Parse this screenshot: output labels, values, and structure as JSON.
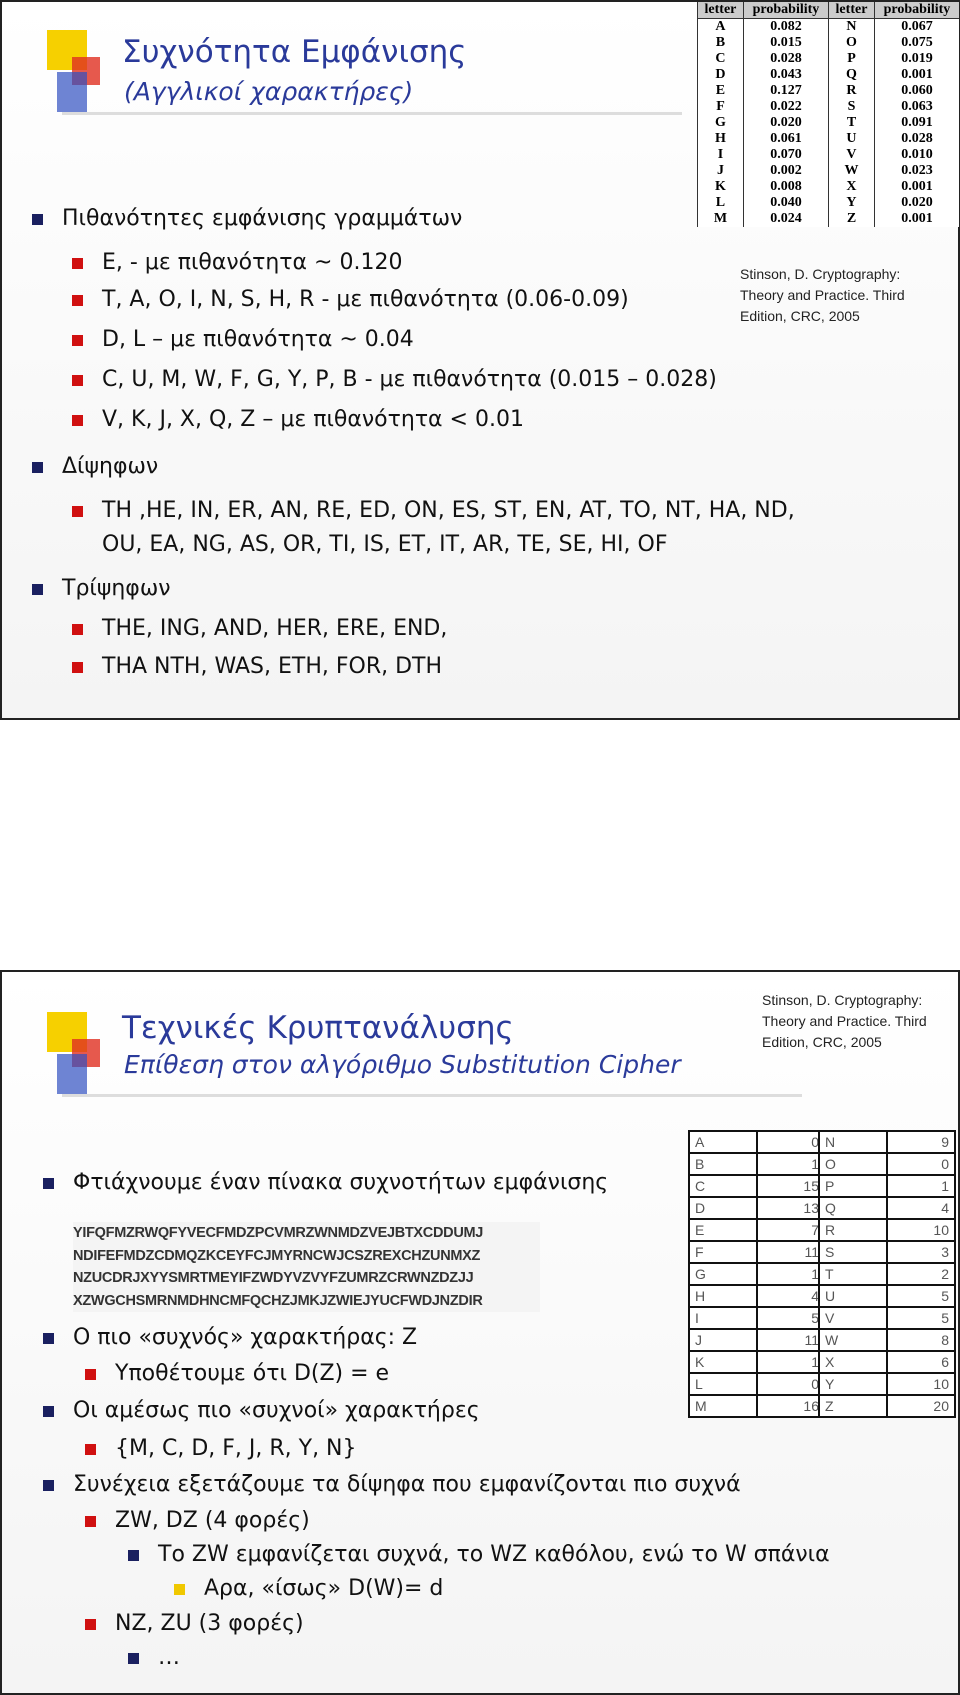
{
  "slide1": {
    "title": "Συχνότητα Εμφάνισης",
    "subtitle": "(Αγγλικοί χαρακτήρες)",
    "table": {
      "headers": [
        "letter",
        "probability",
        "letter",
        "probability"
      ],
      "left": [
        [
          "A",
          "0.082"
        ],
        [
          "B",
          "0.015"
        ],
        [
          "C",
          "0.028"
        ],
        [
          "D",
          "0.043"
        ],
        [
          "E",
          "0.127"
        ],
        [
          "F",
          "0.022"
        ],
        [
          "G",
          "0.020"
        ],
        [
          "H",
          "0.061"
        ],
        [
          "I",
          "0.070"
        ],
        [
          "J",
          "0.002"
        ],
        [
          "K",
          "0.008"
        ],
        [
          "L",
          "0.040"
        ],
        [
          "M",
          "0.024"
        ]
      ],
      "right": [
        [
          "N",
          "0.067"
        ],
        [
          "O",
          "0.075"
        ],
        [
          "P",
          "0.019"
        ],
        [
          "Q",
          "0.001"
        ],
        [
          "R",
          "0.060"
        ],
        [
          "S",
          "0.063"
        ],
        [
          "T",
          "0.091"
        ],
        [
          "U",
          "0.028"
        ],
        [
          "V",
          "0.010"
        ],
        [
          "W",
          "0.023"
        ],
        [
          "X",
          "0.001"
        ],
        [
          "Y",
          "0.020"
        ],
        [
          "Z",
          "0.001"
        ]
      ]
    },
    "citation": [
      "Stinson, D. Cryptography:",
      "Theory and Practice. Third",
      "Edition, CRC, 2005"
    ],
    "bullets": [
      {
        "level": 1,
        "text": "Πιθανότητες εμφάνισης γραμμάτων"
      },
      {
        "level": 2,
        "text": "E, - με πιθανότητα ~ 0.120"
      },
      {
        "level": 2,
        "text": "T, A, O, I, N, S, H, R - με πιθανότητα (0.06-0.09)"
      },
      {
        "level": 2,
        "text": "D, L – με πιθανότητα ~ 0.04"
      },
      {
        "level": 2,
        "text": "C, U, M, W, F, G, Y, P, B - με πιθανότητα (0.015 – 0.028)"
      },
      {
        "level": 2,
        "text": "V, K, J, X, Q, Z – με πιθανότητα < 0.01"
      },
      {
        "level": 1,
        "text": "Δίψηφων"
      },
      {
        "level": 2,
        "text": "TH ,HE, IN, ER, AN, RE, ED, ON, ES, ST, EN, AT, TO, NT, HA, ND,"
      },
      {
        "level": 0,
        "text": "OU, EA, NG, AS, OR, TI, IS, ET, IT, AR, TE, SE, HI, OF"
      },
      {
        "level": 1,
        "text": "Τρίψηφων"
      },
      {
        "level": 2,
        "text": "THE, ING, AND, HER, ERE, END,"
      },
      {
        "level": 2,
        "text": "THA NTH, WAS, ETH, FOR, DTH"
      }
    ]
  },
  "slide2": {
    "title": "Τεχνικές Κρυπτανάλυσης",
    "subtitle": "Επίθεση στον αλγόριθμο Substitution Cipher",
    "citation": [
      "Stinson, D. Cryptography:",
      "Theory and Practice. Third",
      "Edition, CRC, 2005"
    ],
    "ciphertext": [
      "YIFQFMZRWQFYVECFMDZPCVMRZWNMDZVEJBTXCDDUMJ",
      "NDIFEFMDZCDMQZKCEYFCJMYRNCWJCSZREXCHZUNMXZ",
      "NZUCDRJXYYSMRTMEYIFZWDYVZVYFZUMRZCRWNZDZJJ",
      "XZWGCHSMRNMDHNCMFQCHZJMKJZWIEJYUCFWDJNZDIR"
    ],
    "counts": {
      "left": [
        [
          "A",
          "0"
        ],
        [
          "B",
          "1"
        ],
        [
          "C",
          "15"
        ],
        [
          "D",
          "13"
        ],
        [
          "E",
          "7"
        ],
        [
          "F",
          "11"
        ],
        [
          "G",
          "1"
        ],
        [
          "H",
          "4"
        ],
        [
          "I",
          "5"
        ],
        [
          "J",
          "11"
        ],
        [
          "K",
          "1"
        ],
        [
          "L",
          "0"
        ],
        [
          "M",
          "16"
        ]
      ],
      "right": [
        [
          "N",
          "9"
        ],
        [
          "O",
          "0"
        ],
        [
          "P",
          "1"
        ],
        [
          "Q",
          "4"
        ],
        [
          "R",
          "10"
        ],
        [
          "S",
          "3"
        ],
        [
          "T",
          "2"
        ],
        [
          "U",
          "5"
        ],
        [
          "V",
          "5"
        ],
        [
          "W",
          "8"
        ],
        [
          "X",
          "6"
        ],
        [
          "Y",
          "10"
        ],
        [
          "Z",
          "20"
        ]
      ]
    },
    "bullets_top": [
      {
        "level": 1,
        "text": "Φτιάχνουμε έναν πίνακα συχνοτήτων εμφάνισης"
      }
    ],
    "bullets": [
      {
        "level": 1,
        "text": "Ο πιο «συχνός» χαρακτήρας: Z"
      },
      {
        "level": 2,
        "text": "Υποθέτουμε ότι D(Z) = e"
      },
      {
        "level": 1,
        "text": "Οι αμέσως πιο «συχνοί» χαρακτήρες"
      },
      {
        "level": 2,
        "text": "{M, C, D, F, J, R, Y, N}"
      },
      {
        "level": 1,
        "text": "Συνέχεια εξετάζουμε τα δίψηφα που εμφανίζονται πιο συχνά"
      },
      {
        "level": 2,
        "text": "ZW, DZ (4 φορές)"
      },
      {
        "level": 3,
        "text": "Το ZW εμφανίζεται συχνά, το WZ καθόλου, ενώ το W σπάνια"
      },
      {
        "level": 4,
        "text": "Αρα, «ίσως» D(W)= d"
      },
      {
        "level": 2,
        "text": "NZ, ZU (3 φορές)"
      },
      {
        "level": 3,
        "text": "…"
      }
    ]
  },
  "colors": {
    "title": "#2a3a9a",
    "bullet_l1": "#1a2060",
    "bullet_l2": "#d01010",
    "bullet_l4": "#f0c800"
  }
}
